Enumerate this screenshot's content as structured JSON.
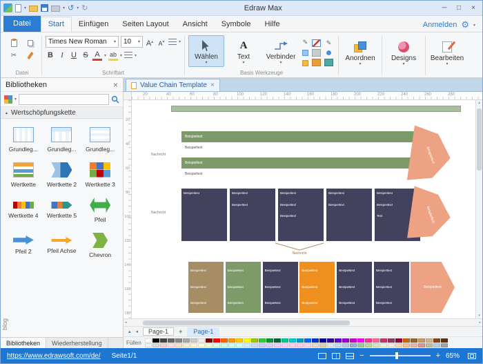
{
  "titlebar": {
    "title": "Edraw Max"
  },
  "menubar": {
    "items": [
      "Datei",
      "Start",
      "Einfügen",
      "Seiten Layout",
      "Ansicht",
      "Symbole",
      "Hilfe"
    ],
    "active": "Start",
    "signin": "Anmelden"
  },
  "ribbon": {
    "groups": {
      "datei": "Datei",
      "schriftart": "Schriftart",
      "basis": "Basis Werkzeuge"
    },
    "font": {
      "name": "Times New Roman",
      "size": "10"
    },
    "format": {
      "bold": "B",
      "italic": "I",
      "underline": "U",
      "strike": "S"
    },
    "tools": {
      "select": "Wählen",
      "text": "Text",
      "connector": "Verbinder"
    },
    "buttons": {
      "arrange": "Anordnen",
      "designs": "Designs",
      "edit": "Bearbeiten"
    }
  },
  "library": {
    "title": "Bibliotheken",
    "section": "Wertschöpfungskette",
    "items": [
      {
        "label": "Grundleg...",
        "icon": "basic1"
      },
      {
        "label": "Grundleg...",
        "icon": "basic2"
      },
      {
        "label": "Grundleg...",
        "icon": "basic3"
      },
      {
        "label": "Wertkette",
        "icon": "chain1"
      },
      {
        "label": "Wertkette 2",
        "icon": "chain2"
      },
      {
        "label": "Wertkette 3",
        "icon": "chain3"
      },
      {
        "label": "Wertkette 4",
        "icon": "chain4"
      },
      {
        "label": "Wertkette 5",
        "icon": "chain5"
      },
      {
        "label": "Pfeil",
        "icon": "arrow-double"
      },
      {
        "label": "Pfeil 2",
        "icon": "arrow-right-blue"
      },
      {
        "label": "Pfeil Achse",
        "icon": "arrow-axis"
      },
      {
        "label": "Chevron",
        "icon": "chevron"
      }
    ]
  },
  "document_tab": {
    "title": "Value Chain Template"
  },
  "canvas": {
    "ruler_top": [
      "20",
      "40",
      "60",
      "80",
      "100",
      "120",
      "140",
      "160",
      "180",
      "200",
      "220",
      "240",
      "260",
      "280"
    ],
    "ruler_left": [
      "20",
      "40",
      "60",
      "80",
      "100",
      "120",
      "140",
      "160",
      "180"
    ]
  },
  "diagram": {
    "sample_text": "Beispieltext",
    "label": "Nachricht",
    "colors": {
      "green": "#7d9b69",
      "lightgreen": "#a9bfa0",
      "navy": "#42425f",
      "orange": "#ee8f1e",
      "salmon": "#eda283",
      "tan": "#a68d64"
    },
    "middle": {
      "columns": [
        {
          "color": "navy",
          "texts": [
            "Beispieltext"
          ]
        },
        {
          "color": "navy",
          "texts": [
            "Beispieltext",
            "Beispieltext"
          ]
        },
        {
          "color": "navy",
          "texts": [
            "Beispieltext",
            "Beispieltext",
            "Beispieltext"
          ]
        },
        {
          "color": "navy",
          "texts": [
            "Beispieltext",
            "Beispieltext"
          ]
        },
        {
          "color": "navy",
          "texts": [
            "Beispieltext",
            "Beispieltext",
            "Text"
          ]
        }
      ]
    },
    "bottom": {
      "columns": [
        {
          "color": "tan",
          "texts": [
            "Beispieltext",
            "Beispieltext",
            "Beispieltext"
          ]
        },
        {
          "color": "green",
          "texts": [
            "Beispieltext",
            "Beispieltext",
            "Beispieltext"
          ]
        },
        {
          "color": "navy",
          "texts": [
            "Beispieltext",
            "Beispieltext",
            "Beispieltext"
          ]
        },
        {
          "color": "orange",
          "texts": [
            "Beispieltext",
            "Beispieltext",
            "Beispieltext"
          ]
        },
        {
          "color": "navy",
          "texts": [
            "Beispieltext",
            "Beispieltext",
            "Beispieltext"
          ]
        },
        {
          "color": "navy",
          "texts": [
            "Beispieltext",
            "Beispieltext",
            "Beispieltext"
          ]
        }
      ]
    }
  },
  "pages": {
    "tab": "Page-1",
    "add": "+",
    "active": "Page-1"
  },
  "palette": {
    "label": "Füllen",
    "rows": [
      [
        "#ffffff",
        "#000000",
        "#444444",
        "#666666",
        "#888888",
        "#aaaaaa",
        "#cccccc",
        "#eeeeee",
        "#7f0000",
        "#ff0000",
        "#ff6600",
        "#ff9900",
        "#ffcc00",
        "#ffff00",
        "#99cc00",
        "#33cc33",
        "#009933",
        "#006633",
        "#00cc99",
        "#00cccc",
        "#0099cc",
        "#0066ff",
        "#0033cc",
        "#000099",
        "#330099",
        "#6600cc",
        "#9900cc",
        "#cc00cc",
        "#ff00ff",
        "#ff3399",
        "#ff6699",
        "#cc3366",
        "#993366",
        "#990033",
        "#cc6600",
        "#996633",
        "#cc9966",
        "#d2b48c",
        "#8b4513",
        "#5c3317"
      ],
      [
        "#f2f2f2",
        "#d9d9d9",
        "#ffcccc",
        "#ffdddd",
        "#ffe0cc",
        "#ffeecc",
        "#fff7cc",
        "#ffffcc",
        "#eeffcc",
        "#ddffdd",
        "#ccffdd",
        "#ccffee",
        "#ccffff",
        "#cceeff",
        "#ccddff",
        "#ccccff",
        "#ddccff",
        "#eeccff",
        "#ffccff",
        "#ffccee",
        "#ffcce0",
        "#f9d5e5",
        "#ecd9c6",
        "#e0cda9",
        "#dce6f1",
        "#c5d9f1",
        "#b8cce4",
        "#95b3d7",
        "#a7c4a0",
        "#c3d69b",
        "#d7e4bc",
        "#ebf1dd",
        "#fde9d9",
        "#fcd5b4",
        "#fabf8f",
        "#e6b8a2",
        "#d99694",
        "#c4bd97",
        "#b9cde5",
        "#a5a5a5"
      ]
    ]
  },
  "bottom_tabs": {
    "libraries": "Bibliotheken",
    "recovery": "Wiederherstellung",
    "blog": "blog"
  },
  "statusbar": {
    "url": "https://www.edrawsoft.com/de/",
    "page": "Seite1/1",
    "zoom": "65%"
  },
  "icons": {
    "close": "×",
    "caret_down": "▾",
    "caret_up": "▴",
    "caret_left": "◂",
    "caret_right": "▸",
    "scissors": "✂",
    "pen": "✎",
    "gear": "⚙",
    "minimize": "─",
    "maximize": "□",
    "undo": "↺",
    "redo": "↻"
  }
}
